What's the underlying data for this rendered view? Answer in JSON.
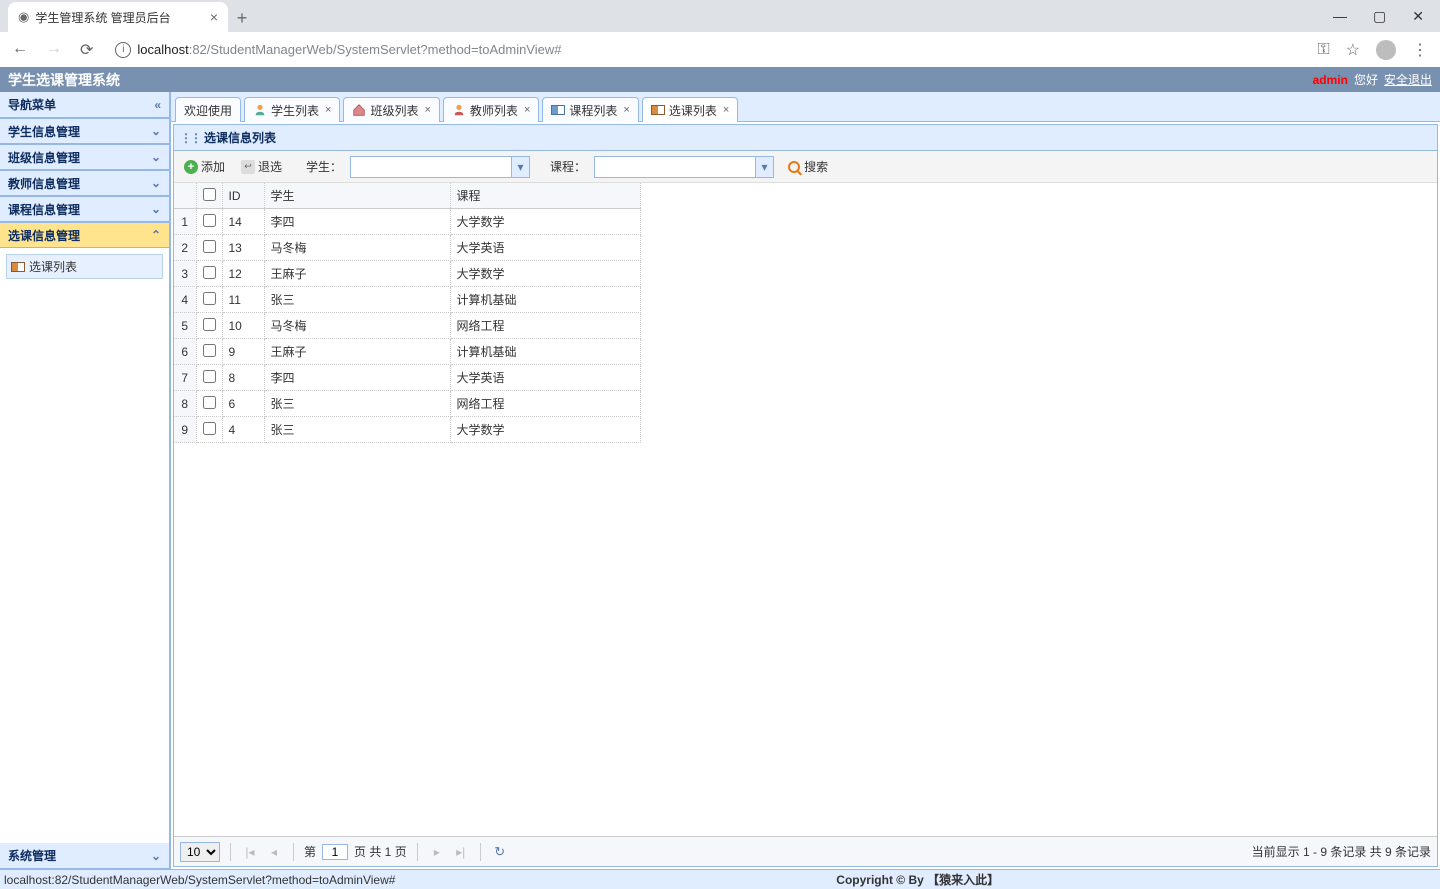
{
  "browser": {
    "tab_title": "学生管理系统 管理员后台",
    "url_host": "localhost",
    "url_port_path": ":82/StudentManagerWeb/SystemServlet?method=toAdminView#",
    "status_url": "localhost:82/StudentManagerWeb/SystemServlet?method=toAdminView#"
  },
  "header": {
    "title": "学生选课管理系统",
    "user": "admin",
    "greeting": "您好",
    "logout": "安全退出"
  },
  "sidebar": {
    "title": "导航菜单",
    "items": [
      "学生信息管理",
      "班级信息管理",
      "教师信息管理",
      "课程信息管理",
      "选课信息管理"
    ],
    "tree_node": "选课列表",
    "bottom": "系统管理"
  },
  "tabs": [
    "欢迎使用",
    "学生列表",
    "班级列表",
    "教师列表",
    "课程列表",
    "选课列表"
  ],
  "panel": {
    "title": "选课信息列表",
    "add": "添加",
    "remove": "退选",
    "student_label": "学生：",
    "course_label": "课程：",
    "search": "搜索"
  },
  "grid": {
    "columns": {
      "id": "ID",
      "student": "学生",
      "course": "课程"
    },
    "rows": [
      {
        "n": "1",
        "id": "14",
        "student": "李四",
        "course": "大学数学"
      },
      {
        "n": "2",
        "id": "13",
        "student": "马冬梅",
        "course": "大学英语"
      },
      {
        "n": "3",
        "id": "12",
        "student": "王麻子",
        "course": "大学数学"
      },
      {
        "n": "4",
        "id": "11",
        "student": "张三",
        "course": "计算机基础"
      },
      {
        "n": "5",
        "id": "10",
        "student": "马冬梅",
        "course": "网络工程"
      },
      {
        "n": "6",
        "id": "9",
        "student": "王麻子",
        "course": "计算机基础"
      },
      {
        "n": "7",
        "id": "8",
        "student": "李四",
        "course": "大学英语"
      },
      {
        "n": "8",
        "id": "6",
        "student": "张三",
        "course": "网络工程"
      },
      {
        "n": "9",
        "id": "4",
        "student": "张三",
        "course": "大学数学"
      }
    ]
  },
  "pagination": {
    "page_size": "10",
    "page_prefix": "第",
    "page_value": "1",
    "page_suffix": "页 共 1 页",
    "info": "当前显示 1 - 9 条记录 共 9 条记录"
  },
  "footer": {
    "copyright": "Copyright © By 【猿来入此】"
  }
}
